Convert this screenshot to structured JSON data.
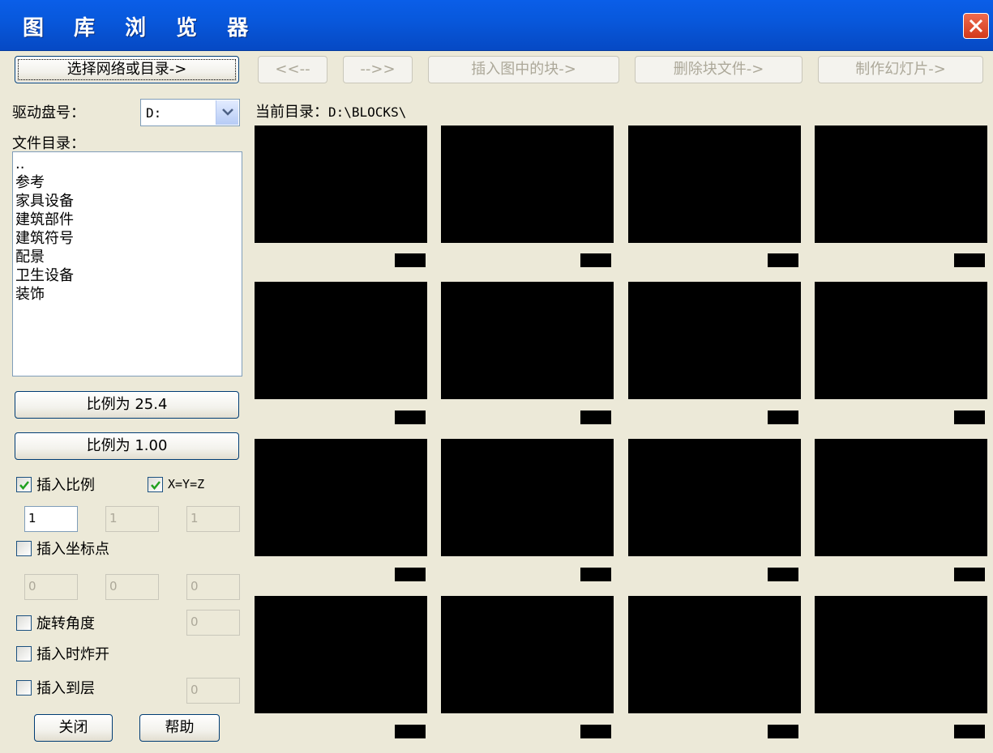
{
  "window": {
    "title": "图 库 浏 览 器",
    "close_label": "X"
  },
  "toolbar": {
    "select_network_label": "选择网络或目录->",
    "prev_label": "<<--",
    "next_label": "-->>",
    "insert_block_label": "插入图中的块->",
    "delete_block_label": "删除块文件->",
    "make_slide_label": "制作幻灯片->"
  },
  "drive": {
    "label": "驱动盘号：",
    "value": "D:"
  },
  "directory": {
    "label": "文件目录：",
    "items": [
      "..",
      "参考",
      "家具设备",
      "建筑部件",
      "建筑符号",
      "配景",
      "卫生设备",
      "装饰"
    ]
  },
  "current_dir": {
    "label": "当前目录：",
    "value": "D:\\BLOCKS\\"
  },
  "scale_buttons": {
    "scale1": "比例为 25.4",
    "scale2": "比例为 1.00"
  },
  "options": {
    "insert_scale": {
      "label": "插入比例",
      "checked": true
    },
    "xyz": {
      "label": "X=Y=Z",
      "checked": true
    },
    "scale_values": [
      "1",
      "1",
      "1"
    ],
    "insert_point": {
      "label": "插入坐标点",
      "checked": false
    },
    "point_values": [
      "0",
      "0",
      "0"
    ],
    "rotation": {
      "label": "旋转角度",
      "checked": false,
      "value": "0"
    },
    "explode": {
      "label": "插入时炸开",
      "checked": false
    },
    "layer": {
      "label": "插入到层",
      "checked": false,
      "value": "0"
    }
  },
  "footer": {
    "close_label": "关闭",
    "help_label": "帮助"
  },
  "colors": {
    "titlebar": "#0858dc",
    "background": "#ece9d8",
    "preview": "#000000"
  }
}
